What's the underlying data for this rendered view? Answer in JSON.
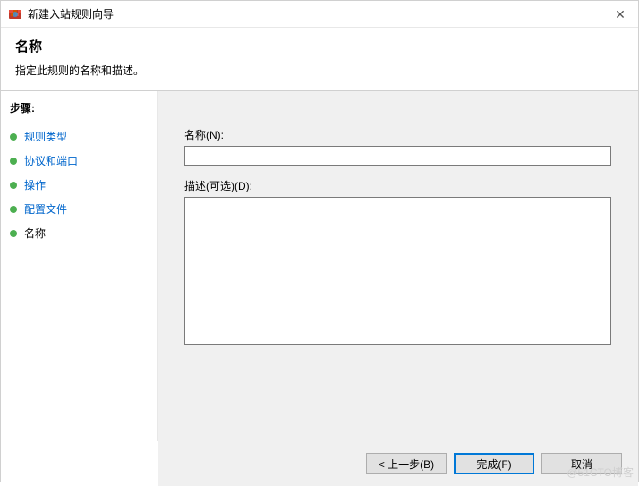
{
  "window": {
    "title": "新建入站规则向导"
  },
  "header": {
    "title": "名称",
    "description": "指定此规则的名称和描述。"
  },
  "sidebar": {
    "steps_label": "步骤:",
    "items": [
      {
        "label": "规则类型",
        "current": false
      },
      {
        "label": "协议和端口",
        "current": false
      },
      {
        "label": "操作",
        "current": false
      },
      {
        "label": "配置文件",
        "current": false
      },
      {
        "label": "名称",
        "current": true
      }
    ]
  },
  "form": {
    "name_label": "名称(N):",
    "name_value": "",
    "description_label": "描述(可选)(D):",
    "description_value": ""
  },
  "buttons": {
    "back": "< 上一步(B)",
    "finish": "完成(F)",
    "cancel": "取消"
  },
  "watermark": "@51CTO博客"
}
